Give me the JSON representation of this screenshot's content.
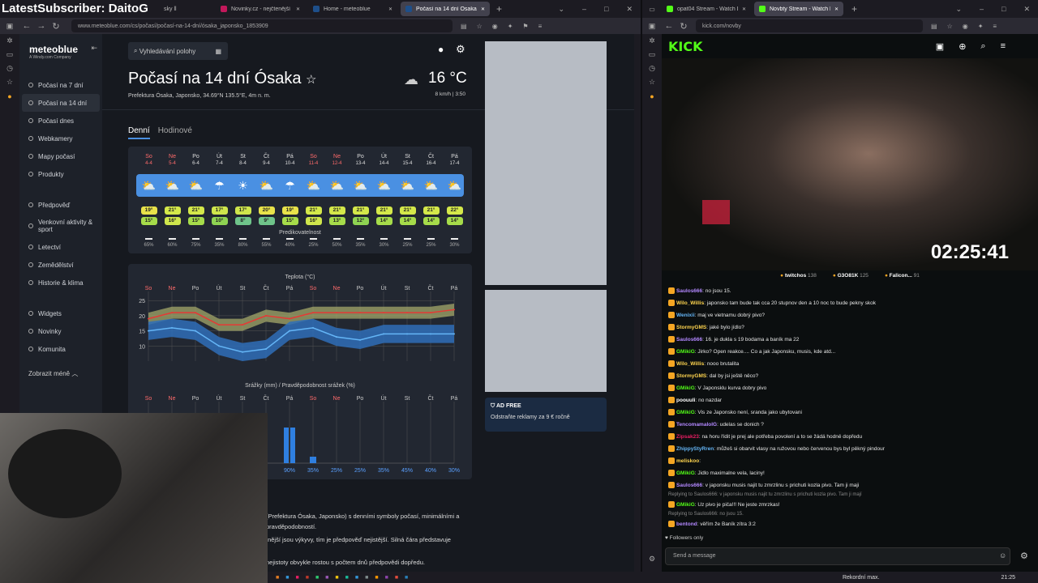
{
  "overlay": {
    "subscriber_text": "LatestSubscriber: DaitoG"
  },
  "browser_left": {
    "tabs": [
      {
        "label": "Novinky.cz - nejčtenější zprávy",
        "color": "#c2185b"
      },
      {
        "label": "Home - meteoblue",
        "color": "#1e4f8a"
      },
      {
        "label": "Počasí na 14 dní Ósaka - mete",
        "color": "#1e4f8a",
        "active": true
      }
    ],
    "first_tab_label": "sky ll",
    "url": "www.meteoblue.com/cs/počasí/počasí-na-14-dní/ósaka_japonsko_1853909"
  },
  "meteoblue": {
    "logo": "meteoblue",
    "logo_sub": "A Windy.com Company",
    "search_placeholder": "Vyhledávání polohy",
    "nav": [
      {
        "label": "Počasí na 7 dní"
      },
      {
        "label": "Počasí na 14 dní",
        "active": true
      },
      {
        "label": "Počasí dnes"
      },
      {
        "label": "Webkamery"
      },
      {
        "label": "Mapy počasí"
      },
      {
        "label": "Produkty"
      }
    ],
    "nav2": [
      {
        "label": "Předpověď"
      },
      {
        "label": "Venkovní aktivity & sport"
      },
      {
        "label": "Letectví"
      },
      {
        "label": "Zemědělství"
      },
      {
        "label": "Historie & klima"
      }
    ],
    "nav3": [
      {
        "label": "Widgets"
      },
      {
        "label": "Novinky"
      },
      {
        "label": "Komunita"
      }
    ],
    "show_more": "Zobrazit méně",
    "title": "Počasí na 14 dní Ósaka",
    "subtitle": "Prefektura Ósaka, Japonsko, 34.69°N 135.5°E, 4m n. m.",
    "current_temp": "16 °C",
    "current_meta": "8 km/h  |  3:50",
    "tabs": [
      {
        "label": "Denní",
        "active": true
      },
      {
        "label": "Hodinové"
      }
    ],
    "days": [
      {
        "d": "So",
        "date": "4-4",
        "weekend": true,
        "icon": "partly-cloudy-icon",
        "max": "19°",
        "min": "15°",
        "pred": "65%"
      },
      {
        "d": "Ne",
        "date": "5-4",
        "weekend": true,
        "icon": "sun-cloud-icon",
        "max": "21°",
        "min": "16°",
        "pred": "60%"
      },
      {
        "d": "Po",
        "date": "6-4",
        "icon": "sun-cloud-icon",
        "max": "21°",
        "min": "15°",
        "pred": "75%"
      },
      {
        "d": "Út",
        "date": "7-4",
        "icon": "rain-cloud-icon",
        "max": "17°",
        "min": "10°",
        "pred": "35%"
      },
      {
        "d": "St",
        "date": "8-4",
        "icon": "sun-icon",
        "max": "17°",
        "min": "8°",
        "pred": "80%"
      },
      {
        "d": "Čt",
        "date": "9-4",
        "icon": "partly-cloudy-icon",
        "max": "20°",
        "min": "9°",
        "pred": "55%"
      },
      {
        "d": "Pá",
        "date": "10-4",
        "icon": "rain-cloud-icon",
        "max": "19°",
        "min": "15°",
        "pred": "40%"
      },
      {
        "d": "So",
        "date": "11-4",
        "weekend": true,
        "icon": "partly-cloudy-icon",
        "max": "21°",
        "min": "16°",
        "pred": "25%"
      },
      {
        "d": "Ne",
        "date": "12-4",
        "weekend": true,
        "icon": "sun-cloud-icon",
        "max": "21°",
        "min": "13°",
        "pred": "50%"
      },
      {
        "d": "Po",
        "date": "13-4",
        "icon": "sun-cloud-icon",
        "max": "21°",
        "min": "12°",
        "pred": "35%"
      },
      {
        "d": "Út",
        "date": "14-4",
        "icon": "sun-cloud-icon",
        "max": "21°",
        "min": "14°",
        "pred": "30%"
      },
      {
        "d": "St",
        "date": "15-4",
        "icon": "sun-cloud-icon",
        "max": "21°",
        "min": "14°",
        "pred": "25%"
      },
      {
        "d": "Čt",
        "date": "16-4",
        "icon": "sun-cloud-icon",
        "max": "21°",
        "min": "14°",
        "pred": "25%"
      },
      {
        "d": "Pá",
        "date": "17-4",
        "icon": "sun-cloud-icon",
        "max": "22°",
        "min": "14°",
        "pred": "30%"
      }
    ],
    "predictability_label": "Predikovatelnost",
    "temp_chart_title": "Teplota (°C)",
    "rain_chart_title": "Srážky (mm) / Pravděpodobnost srážek (%)",
    "rain_percent": [
      "",
      "",
      "",
      "",
      "",
      "",
      "90%",
      "35%",
      "25%",
      "25%",
      "35%",
      "45%",
      "40%",
      "30%"
    ],
    "ad_free_title": "AD FREE",
    "ad_free_text": "Odstraňte reklamy za 9 € ročně",
    "body_text1": "(Prefektura Ósaka, Japonsko) s denními symboly počasí, minimálními a",
    "body_text1b": "pravděpodobností.",
    "body_text2": "tnější jsou výkyvy, tím je předpověď nejistější. Silná čára představuje",
    "body_text3": "nejistoty obvykle rostou s počtem dnů předpovědi dopředu."
  },
  "chart_data": {
    "type": "area",
    "title": "Teplota (°C)",
    "categories": [
      "So",
      "Ne",
      "Po",
      "Út",
      "St",
      "Čt",
      "Pá",
      "So",
      "Ne",
      "Po",
      "Út",
      "St",
      "Čt",
      "Pá"
    ],
    "ylim": [
      5,
      28
    ],
    "yticks": [
      10,
      15,
      20,
      25
    ],
    "series": [
      {
        "values": [
          19,
          21,
          21,
          17,
          17,
          20,
          19,
          21,
          21,
          21,
          21,
          21,
          21,
          22
        ]
      },
      {
        "values": [
          15,
          16,
          15,
          10,
          8,
          9,
          15,
          16,
          13,
          12,
          14,
          14,
          14,
          14
        ]
      }
    ]
  },
  "browser_right": {
    "tabs": [
      {
        "label": "opat04 Stream - Watch Live",
        "color": "#53fc18"
      },
      {
        "label": "Novbty Stream - Watch Live",
        "color": "#53fc18",
        "active": true
      }
    ],
    "url": "kick.com/novby"
  },
  "kick": {
    "logo": "KICK",
    "timer": "02:25:41",
    "gift_leaders": [
      {
        "name": "twitchos",
        "n": "138"
      },
      {
        "name": "G3O81K",
        "n": "125"
      },
      {
        "name": "Falicon...",
        "n": "91"
      }
    ],
    "chat": [
      {
        "user": "Saulos666",
        "color": "#b388ff",
        "msg": ": no jsou 15."
      },
      {
        "user": "Wilo_Willis",
        "color": "#ffd54f",
        "msg": ": japonsko tam bude tak cca 20 stupnov den a 10 noc to bude pekny skok"
      },
      {
        "user": "Wenixii",
        "color": "#64b5f6",
        "msg": ": maj ve vietnamu dobrý pivo?"
      },
      {
        "user": "StormyGMS",
        "color": "#ffd54f",
        "msg": ": jaké bylo jídlo?"
      },
      {
        "user": "Saulos666",
        "color": "#b388ff",
        "msg": ": 16. je dukla s 19 bodama a baník ma 22"
      },
      {
        "user": "GMikiG",
        "color": "#53fc18",
        "msg": ": Jirko? Open reakce.... Co a jak Japonsku, musis, kde atd..."
      },
      {
        "user": "Wilo_Willis",
        "color": "#ffd54f",
        "msg": ": nooo brutalita"
      },
      {
        "user": "StormyGMS",
        "color": "#ffd54f",
        "msg": ": dal by jsi ještě něco?"
      },
      {
        "user": "GMikiG",
        "color": "#53fc18",
        "msg": ": V Japonsklu kurva dobry pivo"
      },
      {
        "user": "poouuli",
        "color": "#ffffff",
        "msg": ": no nazdar"
      },
      {
        "user": "GMikiG",
        "color": "#53fc18",
        "msg": ": Vis ze Japonsko není, sranda jako ubytovani"
      },
      {
        "user": "TencomamalolG",
        "color": "#b388ff",
        "msg": ": udelas se donich ?"
      },
      {
        "user": "Zipsak23",
        "color": "#e91e63",
        "msg": ": na horu řídit je prej ale potřeba povolení a to se žádá hodně dopředu"
      },
      {
        "user": "ZhippyStyRren",
        "color": "#64b5f6",
        "msg": ": můžeš si obarvit vlasy na ružovou nebo červenou bys byl pěkný pindour"
      },
      {
        "user": "meliskoo",
        "color": "#ffd54f",
        "msg": ":"
      },
      {
        "user": "GMikiG",
        "color": "#53fc18",
        "msg": ": Jidlo maximalne vela, laciny!"
      },
      {
        "user": "Saulos666",
        "color": "#b388ff",
        "msg": ": v japonsku musis najit tu zmrzlinu s prichuti kozla pivo. Tam ji maji"
      }
    ],
    "reply1": "Replying to Saulos666: v japonsku musis najit tu zmrzlinu s prichuti kozla pivo. Tam ji mají",
    "chat_after1": {
      "user": "GMikiG",
      "color": "#53fc18",
      "msg": ": Uz pivo je piča!!! Ne jeste zmrzkas!"
    },
    "reply2": "Replying to Saulos666: no jsou 15.",
    "chat_after2": {
      "user": "bentond",
      "color": "#b388ff",
      "msg": ": věřím že Baník zítra 3:2"
    },
    "followers_only": "Followers only",
    "send_placeholder": "Send a message"
  },
  "taskbar": {
    "status": "Rekordní max.",
    "time": "21:25"
  }
}
